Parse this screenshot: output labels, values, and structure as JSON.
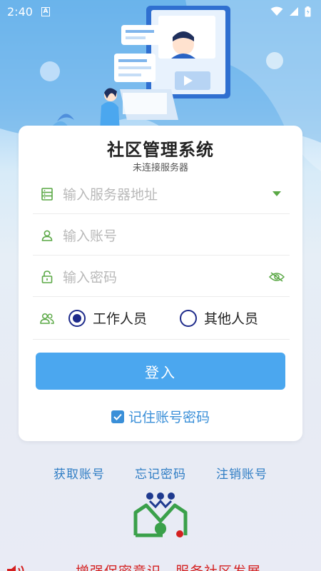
{
  "status_bar": {
    "time": "2:40",
    "notification_icon": "A"
  },
  "card": {
    "title": "社区管理系统",
    "subtitle": "未连接服务器",
    "server_placeholder": "输入服务器地址",
    "account_placeholder": "输入账号",
    "password_placeholder": "输入密码",
    "role_options": [
      "工作人员",
      "其他人员"
    ],
    "selected_role": "工作人员",
    "login_label": "登入",
    "remember_label": "记住账号密码",
    "remember_checked": true
  },
  "links": {
    "get_account": "获取账号",
    "forgot_password": "忘记密码",
    "cancel_account": "注销账号"
  },
  "slogan": "增强保密意识，服务社区发展",
  "colors": {
    "accent": "#4ba7ef",
    "link": "#2f7dc4",
    "icon_green": "#5aa845",
    "radio": "#1d2a8a",
    "slogan": "#d42020"
  }
}
